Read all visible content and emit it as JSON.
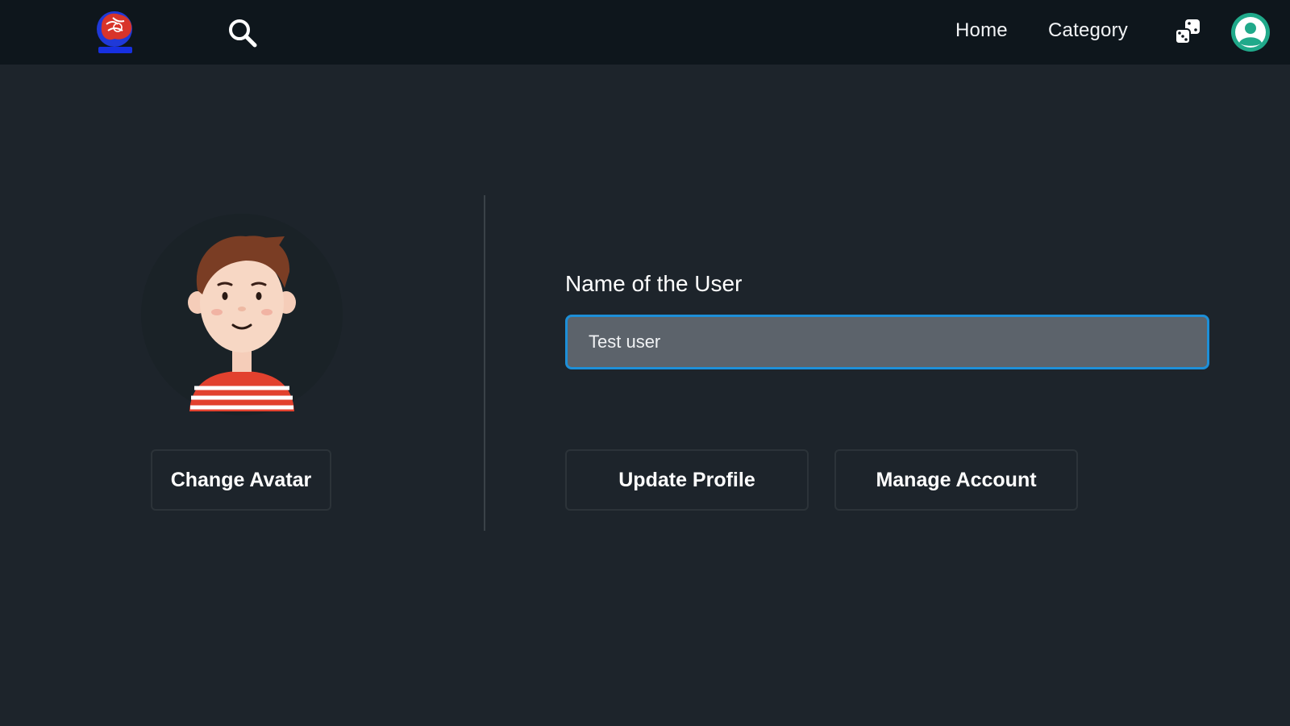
{
  "header": {
    "logo_icon": "brain-logo-icon",
    "search_icon": "search-icon",
    "nav_links": [
      "Home",
      "Category"
    ],
    "dice_icon": "dice-icon",
    "profile_icon": "user-profile-icon",
    "profile_color": "#20a98a"
  },
  "profile": {
    "avatar_icon": "boy-avatar-illustration",
    "change_avatar_label": "Change Avatar",
    "name_label": "Name of the User",
    "name_value": "Test user",
    "update_label": "Update Profile",
    "manage_label": "Manage Account"
  },
  "colors": {
    "background": "#1d242b",
    "header_bg": "#0e161c",
    "input_bg": "#5c636b",
    "input_border": "#1d8fd8",
    "shirt_red": "#e2412e"
  }
}
